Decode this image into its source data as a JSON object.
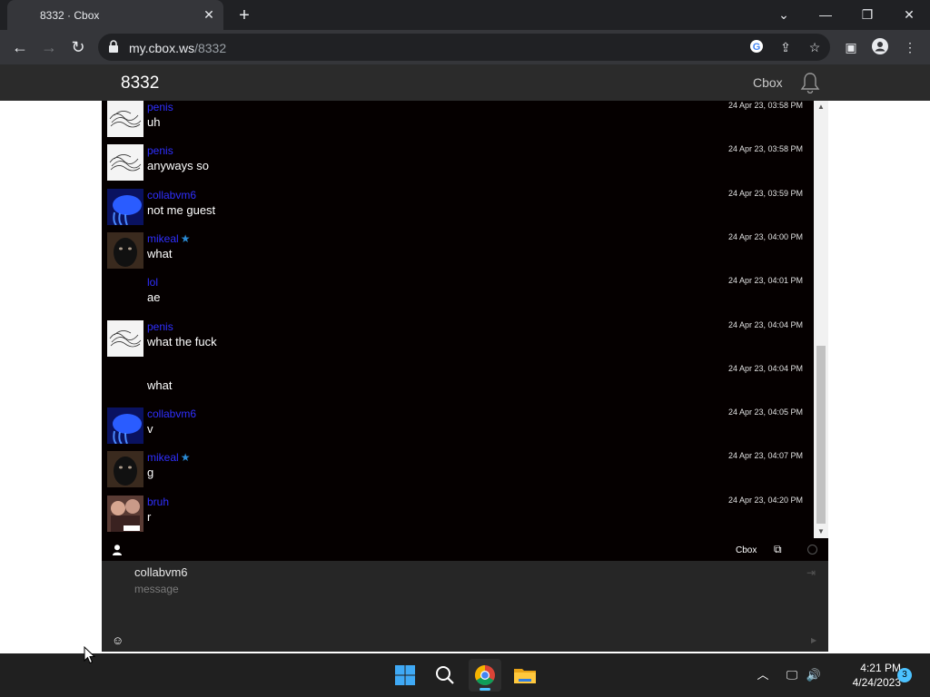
{
  "browser": {
    "tab_title": "8332 · Cbox",
    "url_host": "my.cbox.ws",
    "url_path": "/8332"
  },
  "page": {
    "title": "8332",
    "brand": "Cbox"
  },
  "messages": [
    {
      "user": "penis",
      "text": "uh",
      "time": "24 Apr 23, 03:58 PM",
      "avatar": "sketch",
      "star": false
    },
    {
      "user": "penis",
      "text": "anyways so",
      "time": "24 Apr 23, 03:58 PM",
      "avatar": "sketch",
      "star": false
    },
    {
      "user": "collabvm6",
      "text": "not me guest",
      "time": "24 Apr 23, 03:59 PM",
      "avatar": "blue",
      "star": false
    },
    {
      "user": "mikeal",
      "text": "what",
      "time": "24 Apr 23, 04:00 PM",
      "avatar": "dark",
      "star": true
    },
    {
      "user": "lol",
      "text": "ae",
      "time": "24 Apr 23, 04:01 PM",
      "avatar": "none",
      "star": false
    },
    {
      "user": "penis",
      "text": "what the fuck",
      "time": "24 Apr 23, 04:04 PM",
      "avatar": "sketch",
      "star": false
    },
    {
      "user": "",
      "text": "what",
      "time": "24 Apr 23, 04:04 PM",
      "avatar": "none",
      "star": false
    },
    {
      "user": "collabvm6",
      "text": "v",
      "time": "24 Apr 23, 04:05 PM",
      "avatar": "blue",
      "star": false
    },
    {
      "user": "mikeal",
      "text": "g",
      "time": "24 Apr 23, 04:07 PM",
      "avatar": "dark",
      "star": true
    },
    {
      "user": "bruh",
      "text": "r",
      "time": "24 Apr 23, 04:20 PM",
      "avatar": "photo",
      "star": false
    }
  ],
  "chatbar": {
    "cbox_label": "Cbox"
  },
  "compose": {
    "name": "collabvm6",
    "placeholder": "message"
  },
  "taskbar": {
    "time": "4:21 PM",
    "date": "4/24/2023",
    "notification_count": "3"
  },
  "colors": {
    "username": "#2f2fff",
    "chat_bg": "#050000",
    "accent": "#4cc2ff"
  }
}
